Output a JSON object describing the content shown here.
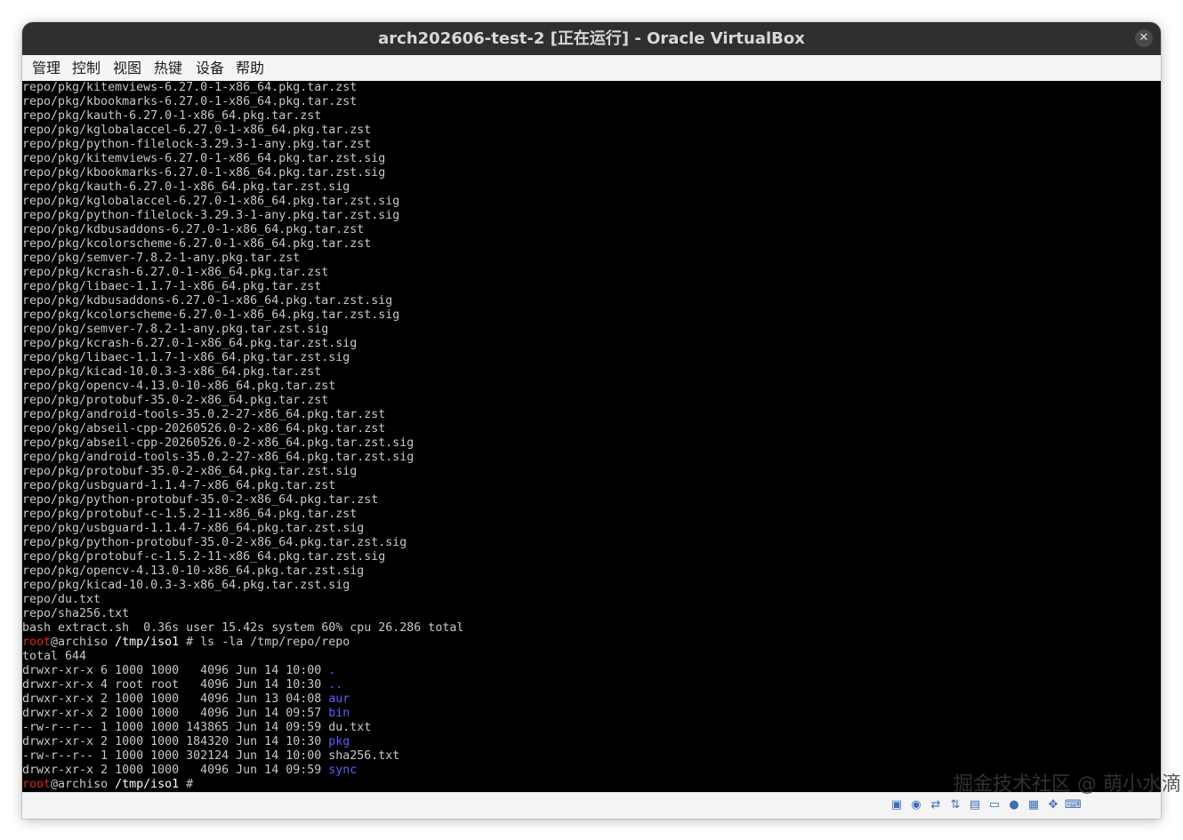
{
  "window": {
    "title": "arch202606-test-2 [正在运行] - Oracle VirtualBox",
    "close_glyph": "✕"
  },
  "menu": [
    {
      "label": "管理"
    },
    {
      "label": "控制"
    },
    {
      "label": "视图"
    },
    {
      "label": "热键"
    },
    {
      "label": "设备"
    },
    {
      "label": "帮助"
    }
  ],
  "terminal": {
    "lines": [
      {
        "text": "repo/pkg/kitemviews-6.27.0-1-x86_64.pkg.tar.zst"
      },
      {
        "text": "repo/pkg/kbookmarks-6.27.0-1-x86_64.pkg.tar.zst"
      },
      {
        "text": "repo/pkg/kauth-6.27.0-1-x86_64.pkg.tar.zst"
      },
      {
        "text": "repo/pkg/kglobalaccel-6.27.0-1-x86_64.pkg.tar.zst"
      },
      {
        "text": "repo/pkg/python-filelock-3.29.3-1-any.pkg.tar.zst"
      },
      {
        "text": "repo/pkg/kitemviews-6.27.0-1-x86_64.pkg.tar.zst.sig"
      },
      {
        "text": "repo/pkg/kbookmarks-6.27.0-1-x86_64.pkg.tar.zst.sig"
      },
      {
        "text": "repo/pkg/kauth-6.27.0-1-x86_64.pkg.tar.zst.sig"
      },
      {
        "text": "repo/pkg/kglobalaccel-6.27.0-1-x86_64.pkg.tar.zst.sig"
      },
      {
        "text": "repo/pkg/python-filelock-3.29.3-1-any.pkg.tar.zst.sig"
      },
      {
        "text": "repo/pkg/kdbusaddons-6.27.0-1-x86_64.pkg.tar.zst"
      },
      {
        "text": "repo/pkg/kcolorscheme-6.27.0-1-x86_64.pkg.tar.zst"
      },
      {
        "text": "repo/pkg/semver-7.8.2-1-any.pkg.tar.zst"
      },
      {
        "text": "repo/pkg/kcrash-6.27.0-1-x86_64.pkg.tar.zst"
      },
      {
        "text": "repo/pkg/libaec-1.1.7-1-x86_64.pkg.tar.zst"
      },
      {
        "text": "repo/pkg/kdbusaddons-6.27.0-1-x86_64.pkg.tar.zst.sig"
      },
      {
        "text": "repo/pkg/kcolorscheme-6.27.0-1-x86_64.pkg.tar.zst.sig"
      },
      {
        "text": "repo/pkg/semver-7.8.2-1-any.pkg.tar.zst.sig"
      },
      {
        "text": "repo/pkg/kcrash-6.27.0-1-x86_64.pkg.tar.zst.sig"
      },
      {
        "text": "repo/pkg/libaec-1.1.7-1-x86_64.pkg.tar.zst.sig"
      },
      {
        "text": "repo/pkg/kicad-10.0.3-3-x86_64.pkg.tar.zst"
      },
      {
        "text": "repo/pkg/opencv-4.13.0-10-x86_64.pkg.tar.zst"
      },
      {
        "text": "repo/pkg/protobuf-35.0-2-x86_64.pkg.tar.zst"
      },
      {
        "text": "repo/pkg/android-tools-35.0.2-27-x86_64.pkg.tar.zst"
      },
      {
        "text": "repo/pkg/abseil-cpp-20260526.0-2-x86_64.pkg.tar.zst"
      },
      {
        "text": "repo/pkg/abseil-cpp-20260526.0-2-x86_64.pkg.tar.zst.sig"
      },
      {
        "text": "repo/pkg/android-tools-35.0.2-27-x86_64.pkg.tar.zst.sig"
      },
      {
        "text": "repo/pkg/protobuf-35.0-2-x86_64.pkg.tar.zst.sig"
      },
      {
        "text": "repo/pkg/usbguard-1.1.4-7-x86_64.pkg.tar.zst"
      },
      {
        "text": "repo/pkg/python-protobuf-35.0-2-x86_64.pkg.tar.zst"
      },
      {
        "text": "repo/pkg/protobuf-c-1.5.2-11-x86_64.pkg.tar.zst"
      },
      {
        "text": "repo/pkg/usbguard-1.1.4-7-x86_64.pkg.tar.zst.sig"
      },
      {
        "text": "repo/pkg/python-protobuf-35.0-2-x86_64.pkg.tar.zst.sig"
      },
      {
        "text": "repo/pkg/protobuf-c-1.5.2-11-x86_64.pkg.tar.zst.sig"
      },
      {
        "text": "repo/pkg/opencv-4.13.0-10-x86_64.pkg.tar.zst.sig"
      },
      {
        "text": "repo/pkg/kicad-10.0.3-3-x86_64.pkg.tar.zst.sig"
      },
      {
        "text": "repo/du.txt"
      },
      {
        "text": "repo/sha256.txt"
      },
      {
        "text": "bash extract.sh  0.36s user 15.42s system 60% cpu 26.286 total"
      },
      {
        "prompt": true,
        "user": "root",
        "host": "@archiso ",
        "cwd": "/tmp/iso1",
        "rest": " # ls -la /tmp/repo/repo"
      },
      {
        "text": "total 644"
      },
      {
        "text": "drwxr-xr-x 6 1000 1000   4096 Jun 14 10:00 ",
        "name": ".",
        "dir": true
      },
      {
        "text": "drwxr-xr-x 4 root root   4096 Jun 14 10:30 ",
        "name": "..",
        "dir": true
      },
      {
        "text": "drwxr-xr-x 2 1000 1000   4096 Jun 13 04:08 ",
        "name": "aur",
        "dir": true
      },
      {
        "text": "drwxr-xr-x 2 1000 1000   4096 Jun 14 09:57 ",
        "name": "bin",
        "dir": true
      },
      {
        "text": "-rw-r--r-- 1 1000 1000 143865 Jun 14 09:59 ",
        "name": "du.txt",
        "dir": false
      },
      {
        "text": "drwxr-xr-x 2 1000 1000 184320 Jun 14 10:30 ",
        "name": "pkg",
        "dir": true
      },
      {
        "text": "-rw-r--r-- 1 1000 1000 302124 Jun 14 10:00 ",
        "name": "sha256.txt",
        "dir": false
      },
      {
        "text": "drwxr-xr-x 2 1000 1000   4096 Jun 14 09:59 ",
        "name": "sync",
        "dir": true
      },
      {
        "prompt": true,
        "user": "root",
        "host": "@archiso ",
        "cwd": "/tmp/iso1",
        "rest": " #"
      }
    ]
  },
  "statusbar": {
    "icons": [
      "disk-icon",
      "optical-icon",
      "usb-icon",
      "network-icon",
      "shared-folder-icon",
      "display-icon",
      "record-icon",
      "cpu-icon",
      "mouse-icon",
      "keyboard-icon"
    ]
  },
  "watermark": {
    "text": "掘金技术社区 @ 萌小水滴"
  },
  "colors": {
    "root_user": "#e02424",
    "directory": "#5c5cff",
    "terminal_text": "#c8c8c8",
    "terminal_bg": "#000000",
    "titlebar_bg": "#2f2f2f"
  }
}
